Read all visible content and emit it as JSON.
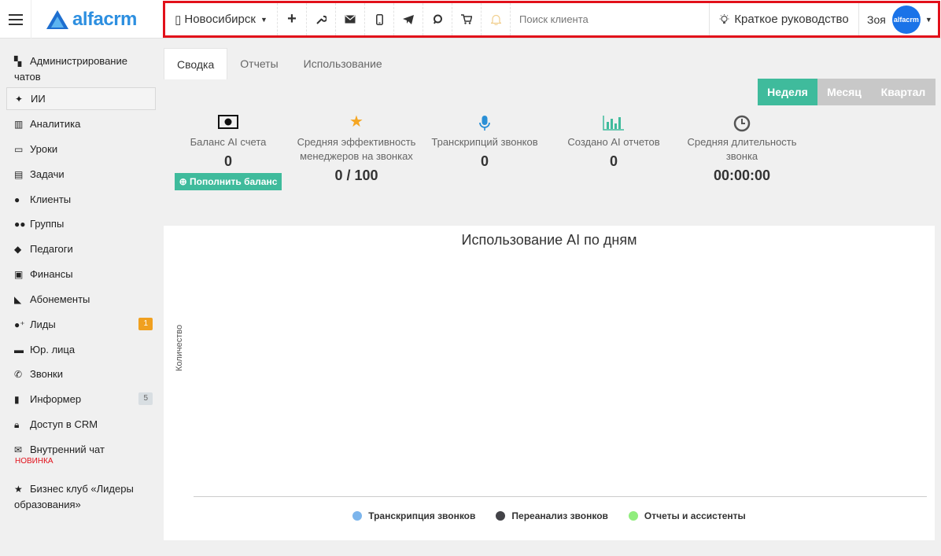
{
  "header": {
    "logo_text": "alfacrm",
    "city": "Новосибирск",
    "search_placeholder": "Поиск клиента",
    "guide_label": "Краткое руководство",
    "user_name": "Зоя",
    "avatar_text": "alfacrm"
  },
  "sidebar": {
    "items": [
      {
        "label": "Администрирование чатов"
      },
      {
        "label": "ИИ"
      },
      {
        "label": "Аналитика"
      },
      {
        "label": "Уроки"
      },
      {
        "label": "Задачи"
      },
      {
        "label": "Клиенты"
      },
      {
        "label": "Группы"
      },
      {
        "label": "Педагоги"
      },
      {
        "label": "Финансы"
      },
      {
        "label": "Абонементы"
      },
      {
        "label": "Лиды",
        "badge": "1"
      },
      {
        "label": "Юр. лица"
      },
      {
        "label": "Звонки"
      },
      {
        "label": "Информер",
        "badge": "5"
      },
      {
        "label": "Доступ в CRM"
      },
      {
        "label": "Внутренний чат",
        "tag": "НОВИНКА"
      },
      {
        "label": "Бизнес клуб «Лидеры образования»"
      }
    ]
  },
  "tabs": [
    {
      "label": "Сводка"
    },
    {
      "label": "Отчеты"
    },
    {
      "label": "Использование"
    }
  ],
  "period": [
    "Неделя",
    "Месяц",
    "Квартал"
  ],
  "stats": {
    "balance": {
      "label": "Баланс AI счета",
      "value": "0",
      "button": "Пополнить баланс"
    },
    "efficiency": {
      "label": "Средняя эффективность менеджеров на звонках",
      "value": "0 / 100"
    },
    "transcripts": {
      "label": "Транскрипций звонков",
      "value": "0"
    },
    "reports": {
      "label": "Создано AI отчетов",
      "value": "0"
    },
    "duration": {
      "label": "Средняя длительность звонка",
      "value": "00:00:00"
    }
  },
  "chart_data": {
    "type": "bar",
    "title": "Использование AI по дням",
    "ylabel": "Количество",
    "xlabel": "",
    "categories": [],
    "series": [
      {
        "name": "Транскрипция звонков",
        "color": "#7cb5ec",
        "values": []
      },
      {
        "name": "Переанализ звонков",
        "color": "#434348",
        "values": []
      },
      {
        "name": "Отчеты и ассистенты",
        "color": "#90ed7d",
        "values": []
      }
    ],
    "legend": "bottom"
  }
}
